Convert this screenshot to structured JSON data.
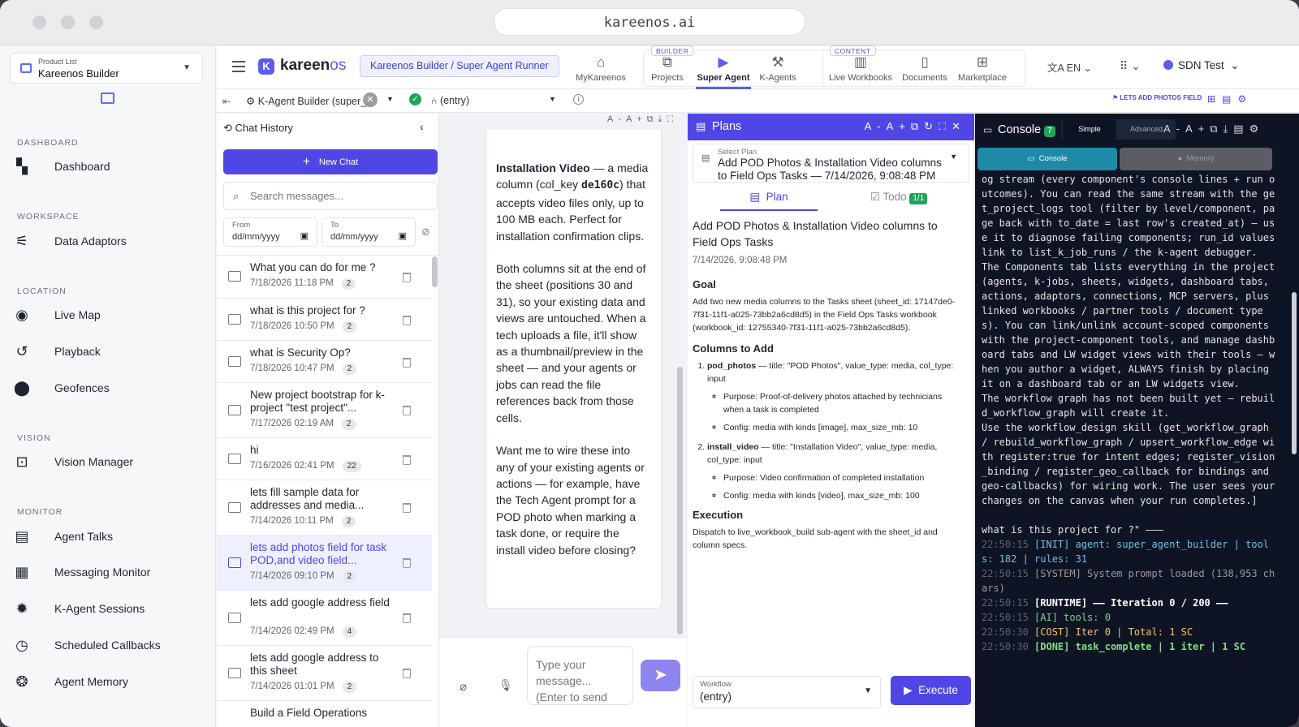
{
  "browser": {
    "url": "kareenos.ai"
  },
  "sidebar": {
    "product_label": "Product List",
    "product_value": "Kareenos Builder",
    "sections": {
      "dashboard": "DASHBOARD",
      "workspace": "WORKSPACE",
      "location": "LOCATION",
      "vision": "VISION",
      "monitor": "MONITOR"
    },
    "items": {
      "dashboard": "Dashboard",
      "data_adaptors": "Data Adaptors",
      "live_map": "Live Map",
      "playback": "Playback",
      "geofences": "Geofences",
      "vision_manager": "Vision Manager",
      "agent_talks": "Agent Talks",
      "messaging_monitor": "Messaging Monitor",
      "k_agent_sessions": "K-Agent Sessions",
      "scheduled_callbacks": "Scheduled Callbacks",
      "agent_memory": "Agent Memory"
    }
  },
  "header": {
    "brand": "kareen",
    "brand_suffix": "os",
    "logo_letter": "K",
    "breadcrumb": "Kareenos Builder / Super Agent Runner",
    "tags": {
      "builder": "BUILDER",
      "content": "CONTENT"
    },
    "nav": {
      "mykareenos": "MyKareenos",
      "projects": "Projects",
      "super_agent": "Super Agent",
      "k_agents": "K-Agents",
      "live_workbooks": "Live Workbooks",
      "documents": "Documents",
      "marketplace": "Marketplace"
    },
    "lang": "EN",
    "user": "SDN Test"
  },
  "toolbar": {
    "agent_select": "K-Agent Builder (super_",
    "entry_select": "(entry)",
    "badge": "LETS ADD PHOTOS FIELD"
  },
  "history": {
    "title": "Chat History",
    "new_chat": "New Chat",
    "search_placeholder": "Search messages...",
    "from_label": "From",
    "to_label": "To",
    "date_placeholder": "dd/mm/yyyy",
    "items": [
      {
        "title": "What you can do for me ?",
        "date": "7/18/2026 11:18 PM",
        "count": "2"
      },
      {
        "title": "what is this project for ?",
        "date": "7/18/2026 10:50 PM",
        "count": "2"
      },
      {
        "title": "what is Security Op?",
        "date": "7/18/2026 10:47 PM",
        "count": "2"
      },
      {
        "title": "New project bootstrap for k-project \"test project\"...",
        "date": "7/17/2026 02:19 AM",
        "count": "2"
      },
      {
        "title": "hi",
        "date": "7/16/2026 02:41 PM",
        "count": "22"
      },
      {
        "title": "lets fill sample data for addresses and media...",
        "date": "7/14/2026 10:11 PM",
        "count": "2"
      },
      {
        "title": "lets add photos field for task POD,and video field...",
        "date": "7/14/2026 09:10 PM",
        "count": "2"
      },
      {
        "title": "lets add google address field",
        "date": "7/14/2026 02:49 PM",
        "count": "4"
      },
      {
        "title": "lets add google address to this sheet",
        "date": "7/14/2026 01:01 PM",
        "count": "2"
      },
      {
        "title": "Build a Field Operations",
        "date": "",
        "count": ""
      }
    ]
  },
  "chat": {
    "p1_bold": "Installation Video",
    "p1_a": " — a media column (col_key ",
    "p1_code": "de160c",
    "p1_b": ") that accepts video files only, up to 100 MB each. Perfect for installation confirmation clips.",
    "p2": "Both columns sit at the end of the sheet (positions 30 and 31), so your existing data and views are untouched. When a tech uploads a file, it'll show as a thumbnail/preview in the sheet — and your agents or jobs can read the file references back from those cells.",
    "p3": "Want me to wire these into any of your existing agents or actions — for example, have the Tech Agent prompt for a POD photo when marking a task done, or require the install video before closing?",
    "input_placeholder": "Type your message... (Enter to send"
  },
  "plans": {
    "title": "Plans",
    "select_label": "Select Plan",
    "select_value": "Add POD Photos & Installation Video columns to Field Ops Tasks — 7/14/2026, 9:08:48 PM",
    "tab_plan": "Plan",
    "tab_todo": "Todo",
    "todo_badge": "1/1",
    "plan_title": "Add POD Photos & Installation Video columns to Field Ops Tasks",
    "plan_date": "7/14/2026, 9:08:48 PM",
    "goal_h": "Goal",
    "goal": "Add two new media columns to the Tasks sheet (sheet_id: 17147de0-7f31-11f1-a025-73bb2a6cd8d5) in the Field Ops Tasks workbook (workbook_id: 12755340-7f31-11f1-a025-73bb2a6cd8d5).",
    "cols_h": "Columns to Add",
    "c1_name": "pod_photos",
    "c1_desc": " — title: \"POD Photos\", value_type: media, col_type: input",
    "c1_p": "Purpose: Proof-of-delivery photos attached by technicians when a task is completed",
    "c1_c": "Config: media with kinds [image], max_size_mb: 10",
    "c2_name": "install_video",
    "c2_desc": " — title: \"Installation Video\", value_type: media, col_type: input",
    "c2_p": "Purpose: Video confirmation of completed installation",
    "c2_c": "Config: media with kinds [video], max_size_mb: 100",
    "exec_h": "Execution",
    "exec": "Dispatch to live_workbook_build sub-agent with the sheet_id and column specs.",
    "workflow_label": "Workflow",
    "workflow_value": "(entry)",
    "execute": "Execute"
  },
  "console": {
    "title": "Console",
    "count": "7",
    "simple": "Simple",
    "advanced": "Advanced",
    "tab_console": "Console",
    "tab_memory": "Memory",
    "log_text": "og stream (every component's console lines + run outcomes). You can read the same stream with the get_project_logs tool (filter by level/component, page back with to_date = last row's created_at) — use it to diagnose failing components; run_id values link to list_k_job_runs / the k-agent debugger.\nThe Components tab lists everything in the project (agents, k-jobs, sheets, widgets, dashboard tabs, actions, adaptors, connections, MCP servers, plus linked workbooks / partner tools / document types). You can link/unlink account-scoped components with the project-component tools, and manage dashboard tabs and LW widget views with their tools — when you author a widget, ALWAYS finish by placing it on a dashboard tab or an LW widgets view.\nThe workflow graph has not been built yet — rebuild_workflow_graph will create it.\nUse the workflow_design skill (get_workflow_graph / rebuild_workflow_graph / upsert_workflow_edge with register:true for intent edges; register_vision_binding / register_geo_callback for bindings and geo-callbacks) for wiring work. The user sees your changes on the canvas when your run completes.]\n\nwhat is this project for ?\" ———",
    "lines": [
      {
        "ts": "22:50:15",
        "text": "[INIT] agent: super_agent_builder | tools: 182 | rules: 31"
      },
      {
        "ts": "22:50:15",
        "text": "[SYSTEM] System prompt loaded (138,953 chars)"
      },
      {
        "ts": "22:50:15",
        "text": "[RUNTIME] —— Iteration 0 / 200 ——"
      },
      {
        "ts": "22:50:15",
        "text": "[AI] tools: 0"
      },
      {
        "ts": "22:50:30",
        "text": "[COST] Iter 0 | Total: 1 SC"
      },
      {
        "ts": "22:50:30",
        "text": "[DONE] task_complete | 1 iter | 1 SC"
      }
    ]
  }
}
